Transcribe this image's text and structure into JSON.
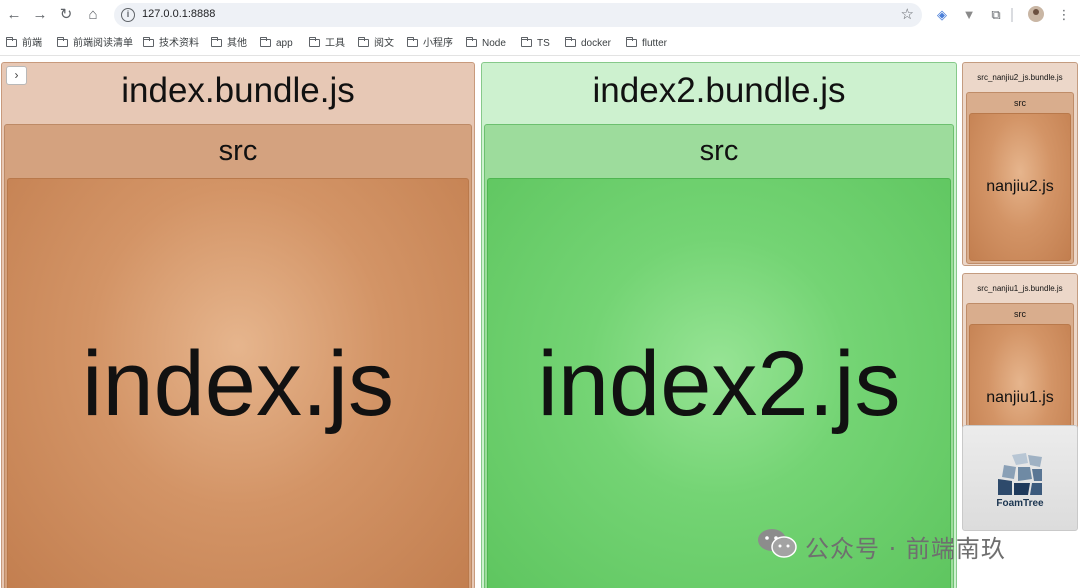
{
  "browser": {
    "url": "127.0.0.1:8888",
    "icons": {
      "back": "arrow-left-icon",
      "forward": "arrow-right-icon",
      "reload": "reload-icon",
      "home": "home-icon",
      "info": "info-icon",
      "bookmark": "star-icon",
      "extensions": "puzzle-icon",
      "menu": "kebab-menu-icon"
    }
  },
  "bookmarks": [
    {
      "label": "前端"
    },
    {
      "label": "前端阅读清单"
    },
    {
      "label": "技术资料"
    },
    {
      "label": "其他"
    },
    {
      "label": "app"
    },
    {
      "label": "工具"
    },
    {
      "label": "阅文"
    },
    {
      "label": "小程序"
    },
    {
      "label": "Node"
    },
    {
      "label": "TS"
    },
    {
      "label": "docker"
    },
    {
      "label": "flutter"
    }
  ],
  "treemap": {
    "toggle_label": "›",
    "bundles": [
      {
        "name": "index.bundle.js",
        "folder": "src",
        "file": "index.js",
        "color": "#d39466"
      },
      {
        "name": "index2.bundle.js",
        "folder": "src",
        "file": "index2.js",
        "color": "#74d474"
      },
      {
        "name": "src_nanjiu2_js.bundle.js",
        "folder": "src",
        "file": "nanjiu2.js",
        "color": "#d39466"
      },
      {
        "name": "src_nanjiu1_js.bundle.js",
        "folder": "src",
        "file": "nanjiu1.js",
        "color": "#d39466"
      }
    ],
    "brand": "FoamTree"
  },
  "watermark": {
    "text": "公众号 · 前端南玖"
  }
}
